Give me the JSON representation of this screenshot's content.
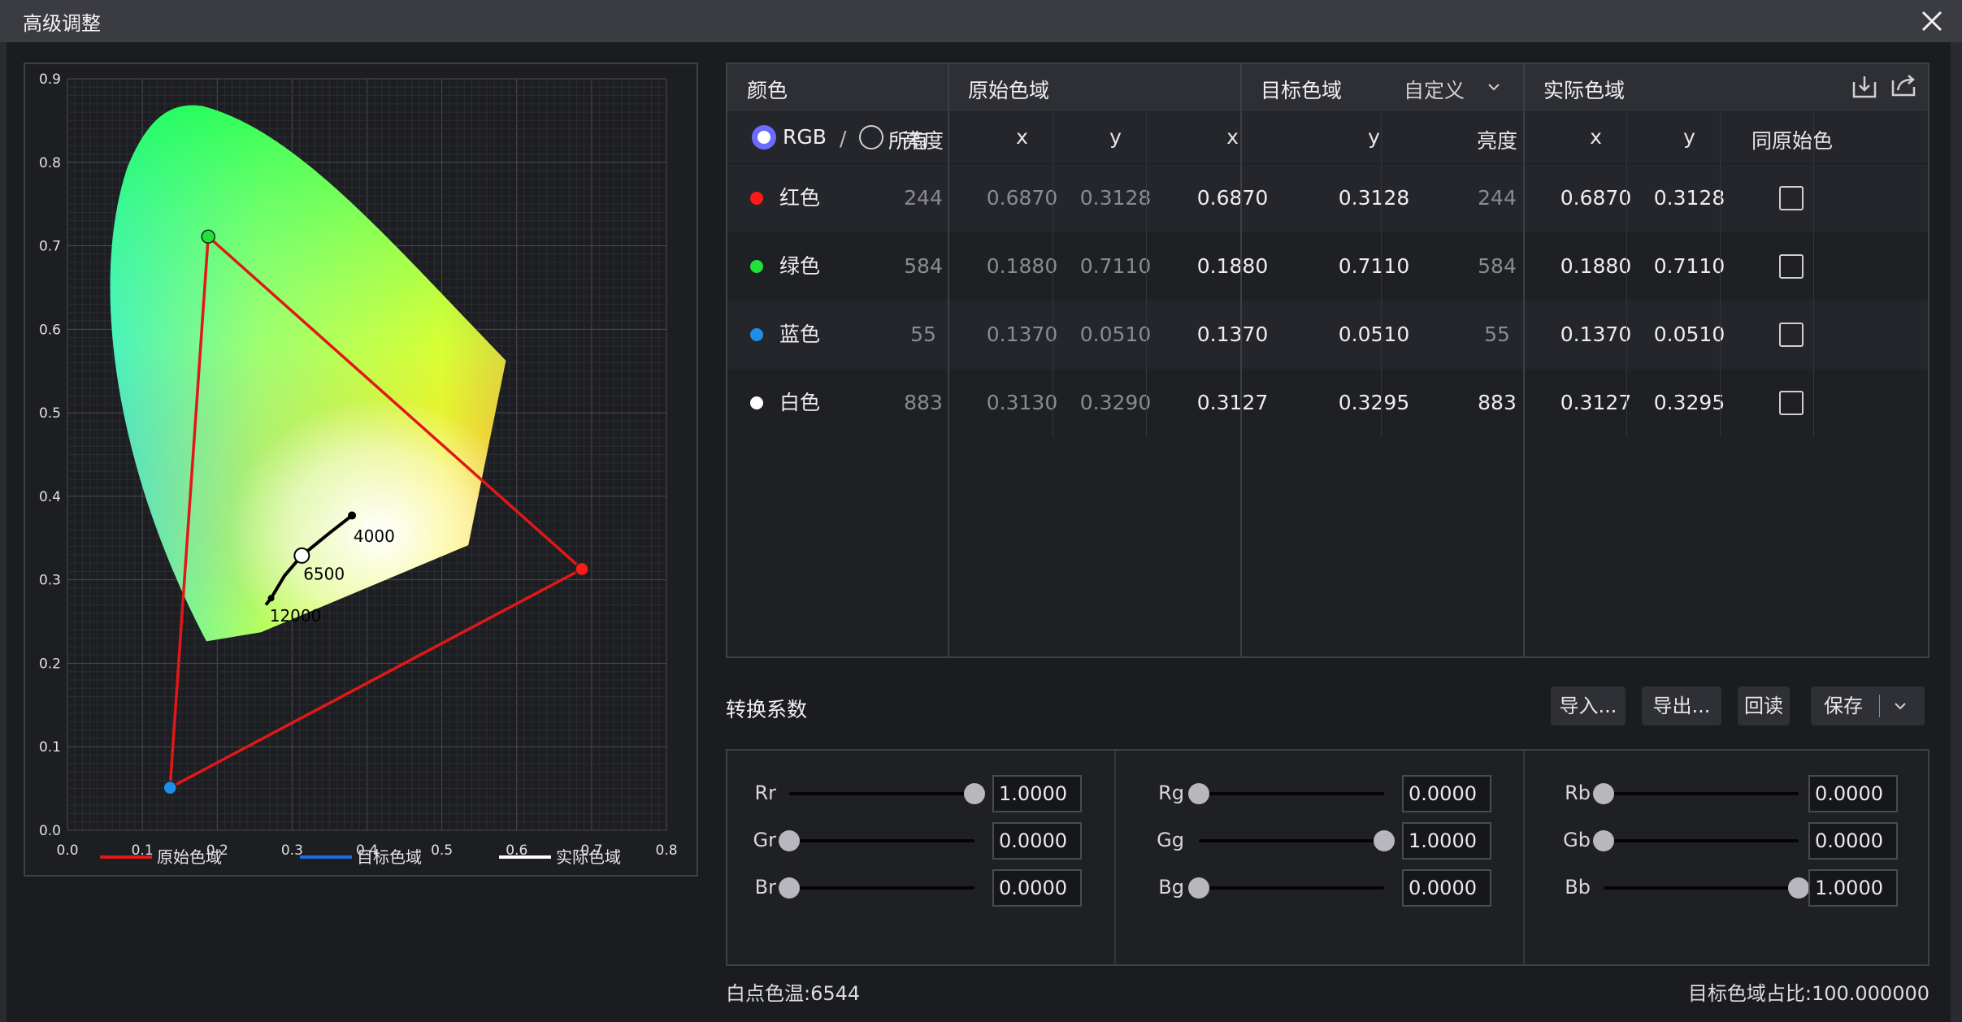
{
  "window": {
    "title": "高级调整"
  },
  "cie": {
    "x_ticks": [
      "0.0",
      "0.1",
      "0.2",
      "0.3",
      "0.4",
      "0.5",
      "0.6",
      "0.7",
      "0.8"
    ],
    "y_ticks": [
      "0.0",
      "0.1",
      "0.2",
      "0.3",
      "0.4",
      "0.5",
      "0.6",
      "0.7",
      "0.8",
      "0.9"
    ],
    "cct_labels": [
      "4000",
      "6500",
      "12000"
    ],
    "legend": [
      {
        "label": "原始色域",
        "color": "#e01818"
      },
      {
        "label": "目标色域",
        "color": "#1a6fe0"
      },
      {
        "label": "实际色域",
        "color": "#ffffff"
      }
    ]
  },
  "table": {
    "headers": {
      "color": "颜色",
      "original": "原始色域",
      "target": "目标色域",
      "target_mode": "自定义",
      "actual": "实际色域"
    },
    "filter": {
      "rgb": "RGB",
      "separator": "/",
      "all": "所有",
      "selected": "RGB"
    },
    "sub_headers": {
      "orig_lum": "亮度",
      "orig_x": "x",
      "orig_y": "y",
      "tgt_x": "x",
      "tgt_y": "y",
      "act_lum": "亮度",
      "act_x": "x",
      "act_y": "y",
      "same": "同原始色"
    },
    "rows": [
      {
        "name": "红色",
        "dot": "#ff1a1a",
        "orig_lum": "244",
        "orig_x": "0.6870",
        "orig_y": "0.3128",
        "tgt_x": "0.6870",
        "tgt_y": "0.3128",
        "act_lum": "244",
        "act_x": "0.6870",
        "act_y": "0.3128",
        "same": false
      },
      {
        "name": "绿色",
        "dot": "#22e23a",
        "orig_lum": "584",
        "orig_x": "0.1880",
        "orig_y": "0.7110",
        "tgt_x": "0.1880",
        "tgt_y": "0.7110",
        "act_lum": "584",
        "act_x": "0.1880",
        "act_y": "0.7110",
        "same": false
      },
      {
        "name": "蓝色",
        "dot": "#1e8fe8",
        "orig_lum": "55",
        "orig_x": "0.1370",
        "orig_y": "0.0510",
        "tgt_x": "0.1370",
        "tgt_y": "0.0510",
        "act_lum": "55",
        "act_x": "0.1370",
        "act_y": "0.0510",
        "same": false
      },
      {
        "name": "白色",
        "dot": "#ffffff",
        "orig_lum": "883",
        "orig_x": "0.3130",
        "orig_y": "0.3290",
        "tgt_x": "0.3127",
        "tgt_y": "0.3295",
        "act_lum": "883",
        "act_x": "0.3127",
        "act_y": "0.3295",
        "same": false
      }
    ]
  },
  "conversion": {
    "title": "转换系数",
    "buttons": {
      "import": "导入...",
      "export": "导出...",
      "readback": "回读",
      "save": "保存"
    },
    "coefficients": [
      {
        "label": "Rr",
        "value": "1.0000",
        "level": 1.0
      },
      {
        "label": "Gr",
        "value": "0.0000",
        "level": 0.0
      },
      {
        "label": "Br",
        "value": "0.0000",
        "level": 0.0
      },
      {
        "label": "Rg",
        "value": "0.0000",
        "level": 0.0
      },
      {
        "label": "Gg",
        "value": "1.0000",
        "level": 1.0
      },
      {
        "label": "Bg",
        "value": "0.0000",
        "level": 0.0
      },
      {
        "label": "Rb",
        "value": "0.0000",
        "level": 0.0
      },
      {
        "label": "Gb",
        "value": "0.0000",
        "level": 0.0
      },
      {
        "label": "Bb",
        "value": "1.0000",
        "level": 1.0
      }
    ]
  },
  "footer": {
    "white_point": "白点色温:6544",
    "target_ratio": "目标色域占比:100.000000"
  }
}
